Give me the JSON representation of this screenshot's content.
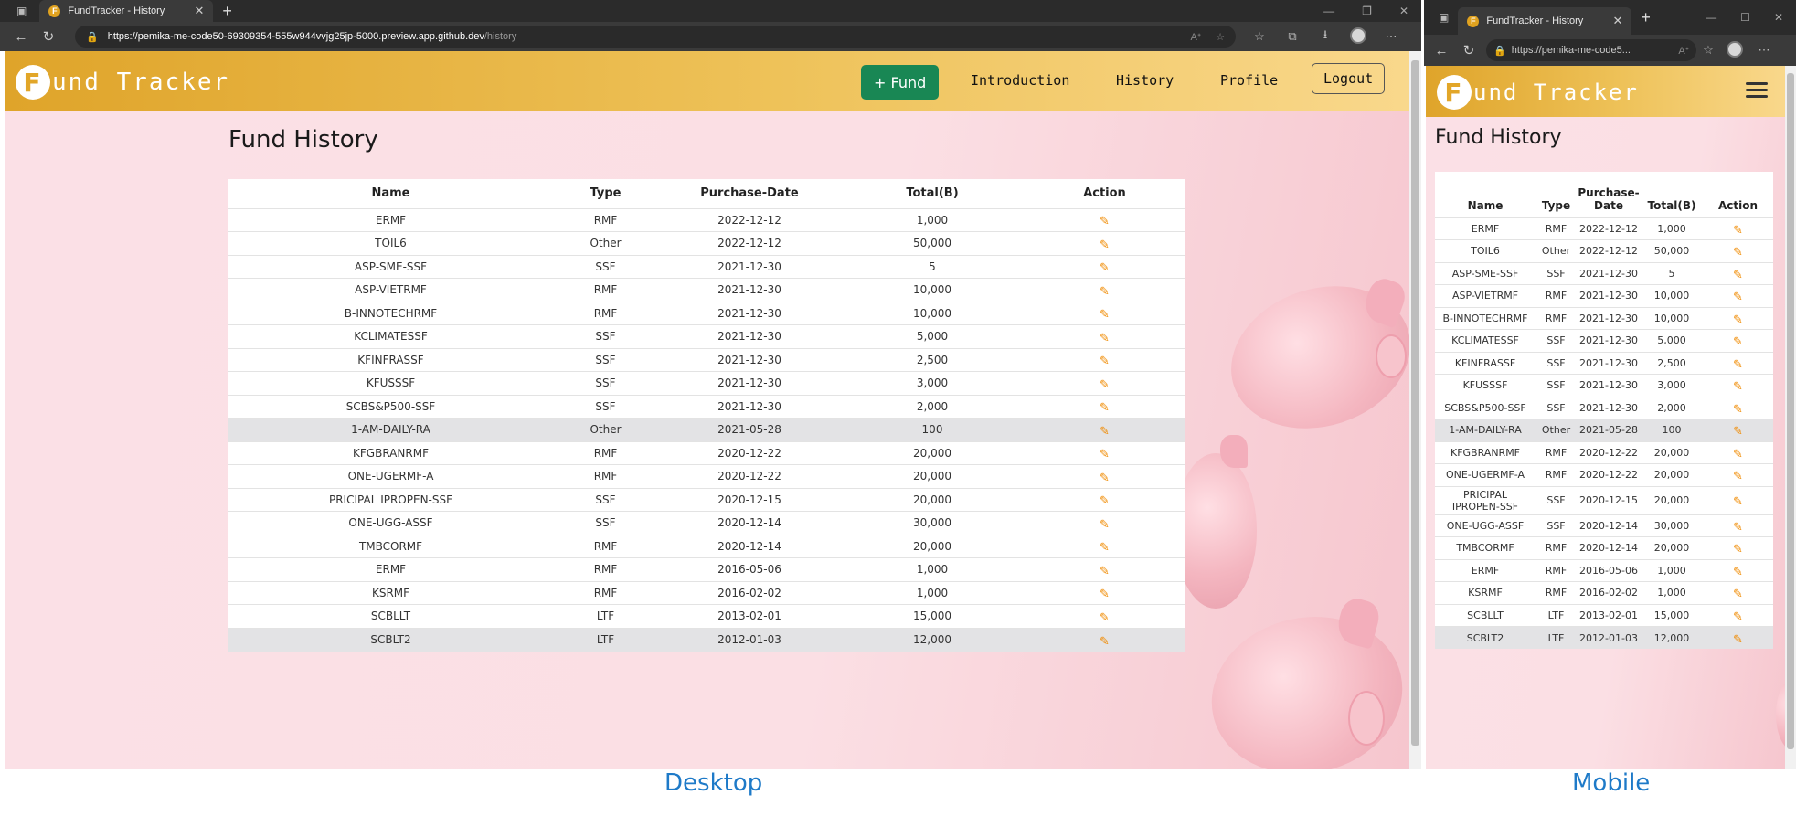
{
  "browser": {
    "tab_title": "FundTracker - History",
    "url_host": "https://pemika-me-code50-69309354-555w944vvjg25jp-5000.preview.app.github.dev",
    "url_path": "/history",
    "mobile_url": "https://pemika-me-code5..."
  },
  "nav": {
    "logo_letter": "F",
    "logo_text": "und Tracker",
    "add_fund": "+ Fund",
    "introduction": "Introduction",
    "history": "History",
    "profile": "Profile",
    "logout": "Logout"
  },
  "page_title": "Fund History",
  "columns": [
    "Name",
    "Type",
    "Purchase-Date",
    "Total(B)",
    "Action"
  ],
  "mobile_columns": [
    "Name",
    "Type",
    "Purchase-\nDate",
    "Total(B)",
    "Action"
  ],
  "rows": [
    {
      "name": "ERMF",
      "type": "RMF",
      "date": "2022-12-12",
      "total": "1,000",
      "highlight": false
    },
    {
      "name": "TOIL6",
      "type": "Other",
      "date": "2022-12-12",
      "total": "50,000",
      "highlight": false
    },
    {
      "name": "ASP-SME-SSF",
      "type": "SSF",
      "date": "2021-12-30",
      "total": "5",
      "highlight": false
    },
    {
      "name": "ASP-VIETRMF",
      "type": "RMF",
      "date": "2021-12-30",
      "total": "10,000",
      "highlight": false
    },
    {
      "name": "B-INNOTECHRMF",
      "type": "RMF",
      "date": "2021-12-30",
      "total": "10,000",
      "highlight": false
    },
    {
      "name": "KCLIMATESSF",
      "type": "SSF",
      "date": "2021-12-30",
      "total": "5,000",
      "highlight": false
    },
    {
      "name": "KFINFRASSF",
      "type": "SSF",
      "date": "2021-12-30",
      "total": "2,500",
      "highlight": false
    },
    {
      "name": "KFUSSSF",
      "type": "SSF",
      "date": "2021-12-30",
      "total": "3,000",
      "highlight": false
    },
    {
      "name": "SCBS&P500-SSF",
      "type": "SSF",
      "date": "2021-12-30",
      "total": "2,000",
      "highlight": false
    },
    {
      "name": "1-AM-DAILY-RA",
      "type": "Other",
      "date": "2021-05-28",
      "total": "100",
      "highlight": true
    },
    {
      "name": "KFGBRANRMF",
      "type": "RMF",
      "date": "2020-12-22",
      "total": "20,000",
      "highlight": false
    },
    {
      "name": "ONE-UGERMF-A",
      "type": "RMF",
      "date": "2020-12-22",
      "total": "20,000",
      "highlight": false
    },
    {
      "name": "PRICIPAL IPROPEN-SSF",
      "type": "SSF",
      "date": "2020-12-15",
      "total": "20,000",
      "highlight": false
    },
    {
      "name": "ONE-UGG-ASSF",
      "type": "SSF",
      "date": "2020-12-14",
      "total": "30,000",
      "highlight": false
    },
    {
      "name": "TMBCORMF",
      "type": "RMF",
      "date": "2020-12-14",
      "total": "20,000",
      "highlight": false
    },
    {
      "name": "ERMF",
      "type": "RMF",
      "date": "2016-05-06",
      "total": "1,000",
      "highlight": false
    },
    {
      "name": "KSRMF",
      "type": "RMF",
      "date": "2016-02-02",
      "total": "1,000",
      "highlight": false
    },
    {
      "name": "SCBLLT",
      "type": "LTF",
      "date": "2013-02-01",
      "total": "15,000",
      "highlight": false
    },
    {
      "name": "SCBLT2",
      "type": "LTF",
      "date": "2012-01-03",
      "total": "12,000",
      "highlight": true
    }
  ],
  "action_icon": "pencil-icon",
  "captions": {
    "desktop": "Desktop",
    "mobile": "Mobile"
  },
  "colors": {
    "navbar": "#dfa42a",
    "fund_button": "#198754",
    "pencil": "#f08a00",
    "caption": "#1e7ac8"
  }
}
